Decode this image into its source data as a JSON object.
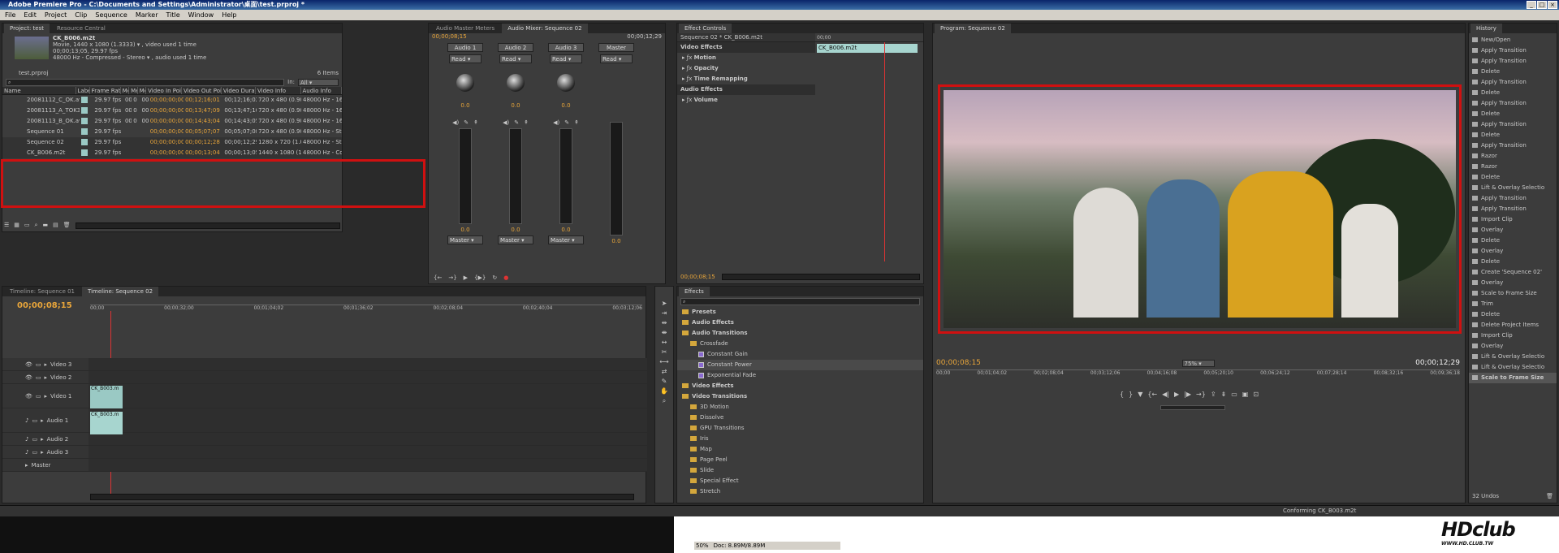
{
  "window": {
    "title": "Adobe Premiere Pro - C:\\Documents and Settings\\Administrator\\桌面\\test.prproj *"
  },
  "menu": [
    "File",
    "Edit",
    "Project",
    "Clip",
    "Sequence",
    "Marker",
    "Title",
    "Window",
    "Help"
  ],
  "project": {
    "tabs": [
      "Project: test",
      "Resource Central"
    ],
    "clip_name": "CK_B006.m2t",
    "clip_info1": "Movie, 1440 x 1080 (1.3333) ▾ , video used 1 time",
    "clip_info2": "00;00;13;05, 29.97 fps",
    "clip_info3": "48000 Hz - Compressed - Stereo ▾ , audio used 1 time",
    "file": "test.prproj",
    "items": "6 Items",
    "in_label": "In:",
    "in_value": "All",
    "columns": [
      "Name",
      "Label",
      "Frame Rate",
      "Me",
      "Me",
      "Me",
      "Video In Point",
      "Video Out Point",
      "Video Duration",
      "Video Info",
      "Audio Info"
    ],
    "rows": [
      [
        "20081112_C_OK.avi",
        "29.97 fps",
        "00",
        "0",
        "00",
        "00;00;00;00",
        "00;12;16;01",
        "00;12;16;02",
        "720 x 480 (0.9091)",
        "48000 Hz - 16-bit -"
      ],
      [
        "20081113_A_TOK3.avi",
        "29.97 fps",
        "00",
        "0",
        "00",
        "00;00;00;00",
        "00;13;47;09",
        "00;13;47;10",
        "720 x 480 (0.9091)",
        "48000 Hz - 16-bit -"
      ],
      [
        "20081113_B_OK.avi",
        "29.97 fps",
        "00",
        "0",
        "00",
        "00;00;00;00",
        "00;14;43;04",
        "00;14;43;05",
        "720 x 480 (0.9091)",
        "48000 Hz - 16-bit -"
      ],
      [
        "Sequence 01",
        "29.97 fps",
        "",
        "",
        "",
        "00;00;00;00",
        "00;05;07;07",
        "00;05;07;08",
        "720 x 480 (0.9091)",
        "48000 Hz - Stereo"
      ],
      [
        "Sequence 02",
        "29.97 fps",
        "",
        "",
        "",
        "00;00;00;00",
        "00;00;12;28",
        "00;00;12;29",
        "1280 x 720 (1.0)",
        "48000 Hz - Stereo"
      ],
      [
        "CK_B006.m2t",
        "29.97 fps",
        "",
        "",
        "",
        "00;00;00;00",
        "00;00;13;04",
        "00;00;13;05",
        "1440 x 1080 (1.333)",
        "48000 Hz - Compr"
      ]
    ]
  },
  "mixer": {
    "tabs": [
      "Audio Master Meters",
      "Audio Mixer: Sequence 02"
    ],
    "time_left": "00;00;08;15",
    "time_right": "00;00;12;29",
    "channels": [
      "Audio 1",
      "Audio 2",
      "Audio 3",
      "Master"
    ],
    "mode": "Read",
    "knob_values": [
      "0.0",
      "0.0",
      "0.0"
    ],
    "fader_values": [
      "0.0",
      "0.0",
      "0.0",
      "0.0"
    ],
    "outputs": [
      "Master",
      "Master",
      "Master"
    ],
    "scale": [
      "0",
      "-6",
      "-12",
      "-18",
      "-24",
      "-30",
      "-36",
      "-42",
      "-48"
    ]
  },
  "effect_controls": {
    "tabs": [
      "Effect Controls"
    ],
    "header": "Sequence 02 * CK_B006.m2t",
    "ruler_time": "00;00",
    "clip_chip": "CK_B006.m2t",
    "video_effects": "Video Effects",
    "items": [
      "Motion",
      "Opacity",
      "Time Remapping"
    ],
    "audio_effects": "Audio Effects",
    "audio_items": [
      "Volume"
    ],
    "time": "00;00;08;15"
  },
  "effects": {
    "tabs": [
      "Effects"
    ],
    "tree": [
      {
        "label": "Presets",
        "level": 0,
        "kind": "folder"
      },
      {
        "label": "Audio Effects",
        "level": 0,
        "kind": "folder"
      },
      {
        "label": "Audio Transitions",
        "level": 0,
        "kind": "folder"
      },
      {
        "label": "Crossfade",
        "level": 1,
        "kind": "folder"
      },
      {
        "label": "Constant Gain",
        "level": 2,
        "kind": "effect"
      },
      {
        "label": "Constant Power",
        "level": 2,
        "kind": "effect"
      },
      {
        "label": "Exponential Fade",
        "level": 2,
        "kind": "effect"
      },
      {
        "label": "Video Effects",
        "level": 0,
        "kind": "folder"
      },
      {
        "label": "Video Transitions",
        "level": 0,
        "kind": "folder"
      },
      {
        "label": "3D Motion",
        "level": 1,
        "kind": "folder"
      },
      {
        "label": "Dissolve",
        "level": 1,
        "kind": "folder"
      },
      {
        "label": "GPU Transitions",
        "level": 1,
        "kind": "folder"
      },
      {
        "label": "Iris",
        "level": 1,
        "kind": "folder"
      },
      {
        "label": "Map",
        "level": 1,
        "kind": "folder"
      },
      {
        "label": "Page Peel",
        "level": 1,
        "kind": "folder"
      },
      {
        "label": "Slide",
        "level": 1,
        "kind": "folder"
      },
      {
        "label": "Special Effect",
        "level": 1,
        "kind": "folder"
      },
      {
        "label": "Stretch",
        "level": 1,
        "kind": "folder"
      }
    ]
  },
  "program": {
    "tabs": [
      "Program: Sequence 02"
    ],
    "time": "00;00;08;15",
    "zoom": "75%",
    "duration": "00;00;12;29",
    "ruler": [
      "00;00",
      "00;01;04;02",
      "00;02;08;04",
      "00;03;12;06",
      "00;04;16;08",
      "00;05;20;10",
      "00;06;24;12",
      "00;07;28;14",
      "00;08;32;16",
      "00;09;36;18"
    ]
  },
  "history": {
    "tab": "History",
    "items": [
      "New/Open",
      "Apply Transition",
      "Apply Transition",
      "Delete",
      "Apply Transition",
      "Delete",
      "Apply Transition",
      "Delete",
      "Apply Transition",
      "Delete",
      "Apply Transition",
      "Razor",
      "Razor",
      "Delete",
      "Lift & Overlay Selectio",
      "Apply Transition",
      "Apply Transition",
      "Import Clip",
      "Overlay",
      "Delete",
      "Overlay",
      "Delete",
      "Create 'Sequence 02'",
      "Overlay",
      "Scale to Frame Size",
      "Trim",
      "Delete",
      "Delete Project Items",
      "Import Clip",
      "Overlay",
      "Lift & Overlay Selectio",
      "Lift & Overlay Selectio",
      "Scale to Frame Size"
    ],
    "undos": "32 Undos"
  },
  "timeline": {
    "tabs": [
      "Timeline: Sequence 01",
      "Timeline: Sequence 02"
    ],
    "time": "00;00;08;15",
    "ruler": [
      "00;00",
      "00;00;32;00",
      "00;01;04;02",
      "00;01;36;02",
      "00;02;08;04",
      "00;02;40;04",
      "00;03;12;06"
    ],
    "tracks": [
      "Video 3",
      "Video 2",
      "Video 1",
      "Audio 1",
      "Audio 2",
      "Audio 3",
      "Master"
    ],
    "clip_video": "CK_B003.m",
    "clip_audio": "CK_B003.m"
  },
  "status": {
    "conforming": "Conforming CK_B003.m2t",
    "zoom": "50%",
    "doc": "Doc: 8.89M/8.89M",
    "logo": "HDclub",
    "logo_sub": "WWW.HD.CLUB.TW"
  }
}
